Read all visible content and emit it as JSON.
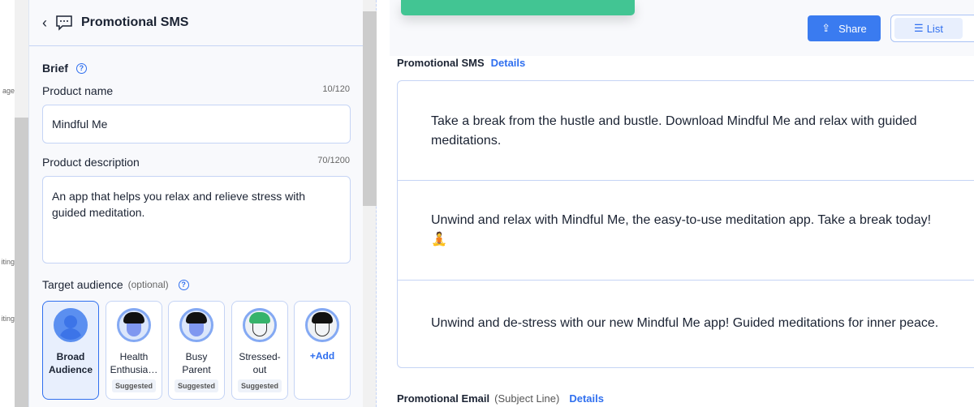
{
  "left_strip": {
    "fragments": [
      "age",
      "iting",
      "iting"
    ]
  },
  "panel": {
    "title": "Promotional SMS",
    "brief_label": "Brief",
    "product_name": {
      "label": "Product name",
      "count": "10/120",
      "value": "Mindful Me"
    },
    "product_description": {
      "label": "Product description",
      "count": "70/1200",
      "value": "An app that helps you relax and relieve stress with guided meditation."
    },
    "target_audience": {
      "label": "Target audience",
      "optional": "(optional)",
      "items": [
        {
          "label": "Broad Audience",
          "selected": true
        },
        {
          "label": "Health Enthusia…",
          "tag": "Suggested"
        },
        {
          "label": "Busy Parent",
          "tag": "Suggested"
        },
        {
          "label": "Stressed-out",
          "tag": "Suggested"
        },
        {
          "label": "+Add"
        }
      ]
    }
  },
  "toolbar": {
    "share": "Share",
    "list": "List"
  },
  "results": {
    "section_title": "Promotional SMS",
    "details": "Details",
    "messages": [
      "Take a break from the hustle and bustle. Download Mindful Me and relax with guided meditations.",
      "Unwind and relax with Mindful Me, the easy-to-use meditation app. Take a break today! 🧘",
      "Unwind and de-stress with our new Mindful Me app! Guided meditations for inner peace."
    ],
    "next_section": {
      "title": "Promotional Email",
      "subtitle": "(Subject Line)",
      "details": "Details"
    }
  },
  "colors": {
    "accent": "#2f6fef",
    "toast": "#42c593",
    "panel_bg": "#f8f9fc"
  }
}
